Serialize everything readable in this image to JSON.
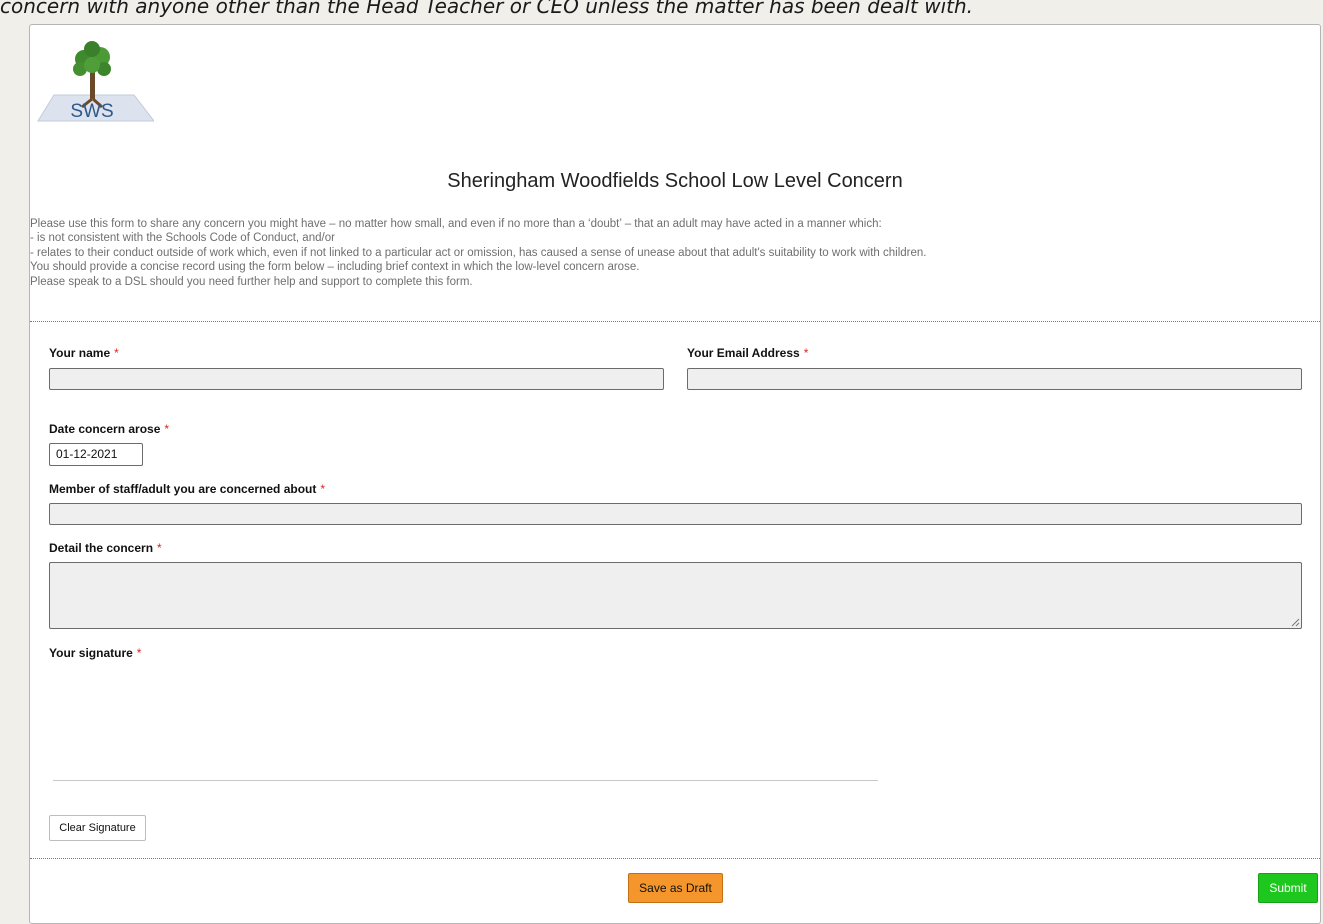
{
  "top_strip": {
    "text": "concern with anyone other than the Head Teacher or CEO unless the matter has been dealt with."
  },
  "logo": {
    "text": "SWS"
  },
  "form": {
    "title": "Sheringham Woodfields School Low Level Concern",
    "intro": [
      "Please use this form to share any concern you might have – no matter how small, and even if no more than a ‘doubt’ – that an adult may have acted in a manner which:",
      "- is not consistent with the Schools Code of Conduct, and/or",
      "- relates to their conduct outside of work which, even if not linked to a particular act or omission, has caused a sense of unease about that adult's suitability to work with children.",
      "You should provide a concise record using the form below – including brief context in which the low-level concern arose.",
      "Please speak to a DSL should you need further help and support to complete this form."
    ],
    "required_marker": "*",
    "fields": {
      "name": {
        "label": "Your name",
        "value": ""
      },
      "email": {
        "label": "Your Email Address",
        "value": ""
      },
      "date": {
        "label": "Date concern arose",
        "value": "01-12-2021"
      },
      "staff": {
        "label": "Member of staff/adult you are concerned about",
        "value": ""
      },
      "detail": {
        "label": "Detail the concern",
        "value": ""
      },
      "signature": {
        "label": "Your signature"
      }
    },
    "buttons": {
      "clear_signature": "Clear Signature",
      "save_draft": "Save as Draft",
      "submit": "Submit"
    }
  },
  "colors": {
    "required": "#d9251c",
    "draft_button": "#f4962b",
    "submit_button": "#1ec71e"
  }
}
